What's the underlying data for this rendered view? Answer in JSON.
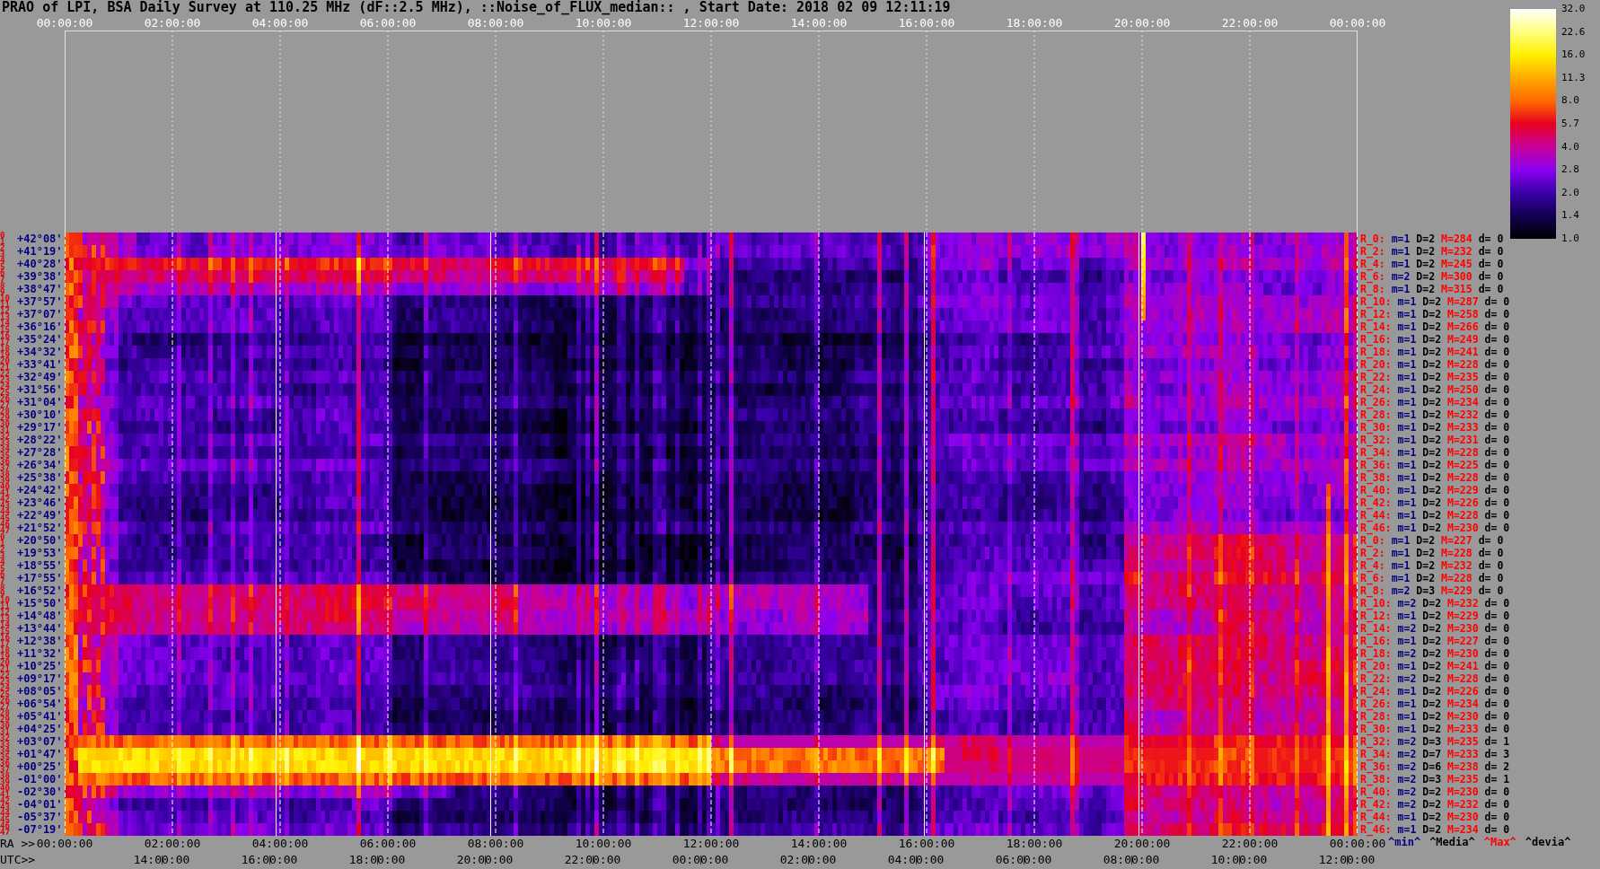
{
  "title": "PRAO of LPI, BSA Daily Survey at 110.25 MHz (dF::2.5 MHz), ::Noise_of_FLUX_median:: , Start Date: 2018 02 09 12:11:19",
  "top_axis": {
    "ticks": [
      "00:00:00",
      "02:00:00",
      "04:00:00",
      "06:00:00",
      "08:00:00",
      "10:00:00",
      "12:00:00",
      "14:00:00",
      "16:00:00",
      "18:00:00",
      "20:00:00",
      "22:00:00",
      "00:00:00"
    ]
  },
  "color_scale": {
    "labels": [
      "32.0",
      "22.6",
      "16.0",
      "11.3",
      "8.0",
      "5.7",
      "4.0",
      "2.8",
      "2.0",
      "1.4",
      "1.0"
    ]
  },
  "rows": [
    {
      "index": [
        "0",
        "1"
      ],
      "declination": "+42°08'",
      "beam": "R_0:",
      "min": "m=1",
      "median": "D=2",
      "max": "M=284",
      "dev": "d= 0"
    },
    {
      "index": [
        "2",
        "3"
      ],
      "declination": "+41°19'",
      "beam": "R_2:",
      "min": "m=1",
      "median": "D=2",
      "max": "M=232",
      "dev": "d= 0"
    },
    {
      "index": [
        "4",
        "5"
      ],
      "declination": "+40°28'",
      "beam": "R_4:",
      "min": "m=1",
      "median": "D=2",
      "max": "M=245",
      "dev": "d= 0"
    },
    {
      "index": [
        "6",
        "7"
      ],
      "declination": "+39°38'",
      "beam": "R_6:",
      "min": "m=2",
      "median": "D=2",
      "max": "M=300",
      "dev": "d= 0"
    },
    {
      "index": [
        "8",
        "9"
      ],
      "declination": "+38°47'",
      "beam": "R_8:",
      "min": "m=1",
      "median": "D=2",
      "max": "M=315",
      "dev": "d= 0"
    },
    {
      "index": [
        "10",
        "11"
      ],
      "declination": "+37°57'",
      "beam": "R_10:",
      "min": "m=1",
      "median": "D=2",
      "max": "M=287",
      "dev": "d= 0"
    },
    {
      "index": [
        "12",
        "13"
      ],
      "declination": "+37°07'",
      "beam": "R_12:",
      "min": "m=1",
      "median": "D=2",
      "max": "M=258",
      "dev": "d= 0"
    },
    {
      "index": [
        "14",
        "15"
      ],
      "declination": "+36°16'",
      "beam": "R_14:",
      "min": "m=1",
      "median": "D=2",
      "max": "M=266",
      "dev": "d= 0"
    },
    {
      "index": [
        "16",
        "17"
      ],
      "declination": "+35°24'",
      "beam": "R_16:",
      "min": "m=1",
      "median": "D=2",
      "max": "M=249",
      "dev": "d= 0"
    },
    {
      "index": [
        "18",
        "19"
      ],
      "declination": "+34°32'",
      "beam": "R_18:",
      "min": "m=1",
      "median": "D=2",
      "max": "M=241",
      "dev": "d= 0"
    },
    {
      "index": [
        "20",
        "21"
      ],
      "declination": "+33°41'",
      "beam": "R_20:",
      "min": "m=1",
      "median": "D=2",
      "max": "M=228",
      "dev": "d= 0"
    },
    {
      "index": [
        "22",
        "23"
      ],
      "declination": "+32°49'",
      "beam": "R_22:",
      "min": "m=1",
      "median": "D=2",
      "max": "M=235",
      "dev": "d= 0"
    },
    {
      "index": [
        "24",
        "25"
      ],
      "declination": "+31°56'",
      "beam": "R_24:",
      "min": "m=1",
      "median": "D=2",
      "max": "M=250",
      "dev": "d= 0"
    },
    {
      "index": [
        "26",
        "27"
      ],
      "declination": "+31°04'",
      "beam": "R_26:",
      "min": "m=1",
      "median": "D=2",
      "max": "M=234",
      "dev": "d= 0"
    },
    {
      "index": [
        "28",
        "29"
      ],
      "declination": "+30°10'",
      "beam": "R_28:",
      "min": "m=1",
      "median": "D=2",
      "max": "M=232",
      "dev": "d= 0"
    },
    {
      "index": [
        "30",
        "31"
      ],
      "declination": "+29°17'",
      "beam": "R_30:",
      "min": "m=1",
      "median": "D=2",
      "max": "M=233",
      "dev": "d= 0"
    },
    {
      "index": [
        "32",
        "33"
      ],
      "declination": "+28°22'",
      "beam": "R_32:",
      "min": "m=1",
      "median": "D=2",
      "max": "M=231",
      "dev": "d= 0"
    },
    {
      "index": [
        "34",
        "35"
      ],
      "declination": "+27°28'",
      "beam": "R_34:",
      "min": "m=1",
      "median": "D=2",
      "max": "M=228",
      "dev": "d= 0"
    },
    {
      "index": [
        "36",
        "37"
      ],
      "declination": "+26°34'",
      "beam": "R_36:",
      "min": "m=1",
      "median": "D=2",
      "max": "M=225",
      "dev": "d= 0"
    },
    {
      "index": [
        "38",
        "39"
      ],
      "declination": "+25°38'",
      "beam": "R_38:",
      "min": "m=1",
      "median": "D=2",
      "max": "M=228",
      "dev": "d= 0"
    },
    {
      "index": [
        "40",
        "41"
      ],
      "declination": "+24°42'",
      "beam": "R_40:",
      "min": "m=1",
      "median": "D=2",
      "max": "M=229",
      "dev": "d= 0"
    },
    {
      "index": [
        "42",
        "43"
      ],
      "declination": "+23°46'",
      "beam": "R_42:",
      "min": "m=1",
      "median": "D=2",
      "max": "M=226",
      "dev": "d= 0"
    },
    {
      "index": [
        "44",
        "45"
      ],
      "declination": "+22°49'",
      "beam": "R_44:",
      "min": "m=1",
      "median": "D=2",
      "max": "M=228",
      "dev": "d= 0"
    },
    {
      "index": [
        "46",
        "47"
      ],
      "declination": "+21°52'",
      "beam": "R_46:",
      "min": "m=1",
      "median": "D=2",
      "max": "M=230",
      "dev": "d= 0"
    },
    {
      "index": [
        "0",
        "1"
      ],
      "declination": "+20°50'",
      "beam": "R_0:",
      "min": "m=1",
      "median": "D=2",
      "max": "M=227",
      "dev": "d= 0"
    },
    {
      "index": [
        "2",
        "3"
      ],
      "declination": "+19°53'",
      "beam": "R_2:",
      "min": "m=1",
      "median": "D=2",
      "max": "M=228",
      "dev": "d= 0"
    },
    {
      "index": [
        "4",
        "5"
      ],
      "declination": "+18°55'",
      "beam": "R_4:",
      "min": "m=1",
      "median": "D=2",
      "max": "M=232",
      "dev": "d= 0"
    },
    {
      "index": [
        "6",
        "7"
      ],
      "declination": "+17°55'",
      "beam": "R_6:",
      "min": "m=1",
      "median": "D=2",
      "max": "M=228",
      "dev": "d= 0"
    },
    {
      "index": [
        "8",
        "9"
      ],
      "declination": "+16°52'",
      "beam": "R_8:",
      "min": "m=2",
      "median": "D=3",
      "max": "M=229",
      "dev": "d= 0"
    },
    {
      "index": [
        "10",
        "11"
      ],
      "declination": "+15°50'",
      "beam": "R_10:",
      "min": "m=2",
      "median": "D=2",
      "max": "M=232",
      "dev": "d= 0"
    },
    {
      "index": [
        "12",
        "13"
      ],
      "declination": "+14°48'",
      "beam": "R_12:",
      "min": "m=1",
      "median": "D=2",
      "max": "M=229",
      "dev": "d= 0"
    },
    {
      "index": [
        "14",
        "15"
      ],
      "declination": "+13°44'",
      "beam": "R_14:",
      "min": "m=2",
      "median": "D=2",
      "max": "M=230",
      "dev": "d= 0"
    },
    {
      "index": [
        "16",
        "17"
      ],
      "declination": "+12°38'",
      "beam": "R_16:",
      "min": "m=1",
      "median": "D=2",
      "max": "M=227",
      "dev": "d= 0"
    },
    {
      "index": [
        "18",
        "19"
      ],
      "declination": "+11°32'",
      "beam": "R_18:",
      "min": "m=2",
      "median": "D=2",
      "max": "M=230",
      "dev": "d= 0"
    },
    {
      "index": [
        "20",
        "21"
      ],
      "declination": "+10°25'",
      "beam": "R_20:",
      "min": "m=1",
      "median": "D=2",
      "max": "M=241",
      "dev": "d= 0"
    },
    {
      "index": [
        "22",
        "23"
      ],
      "declination": "+09°17'",
      "beam": "R_22:",
      "min": "m=2",
      "median": "D=2",
      "max": "M=228",
      "dev": "d= 0"
    },
    {
      "index": [
        "24",
        "25"
      ],
      "declination": "+08°05'",
      "beam": "R_24:",
      "min": "m=1",
      "median": "D=2",
      "max": "M=226",
      "dev": "d= 0"
    },
    {
      "index": [
        "26",
        "27"
      ],
      "declination": "+06°54'",
      "beam": "R_26:",
      "min": "m=1",
      "median": "D=2",
      "max": "M=234",
      "dev": "d= 0"
    },
    {
      "index": [
        "28",
        "29"
      ],
      "declination": "+05°41'",
      "beam": "R_28:",
      "min": "m=1",
      "median": "D=2",
      "max": "M=230",
      "dev": "d= 0"
    },
    {
      "index": [
        "30",
        "31"
      ],
      "declination": "+04°25'",
      "beam": "R_30:",
      "min": "m=1",
      "median": "D=2",
      "max": "M=233",
      "dev": "d= 0"
    },
    {
      "index": [
        "32",
        "33"
      ],
      "declination": "+03°07'",
      "beam": "R_32:",
      "min": "m=2",
      "median": "D=3",
      "max": "M=235",
      "dev": "d= 1"
    },
    {
      "index": [
        "34",
        "35"
      ],
      "declination": "+01°47'",
      "beam": "R_34:",
      "min": "m=2",
      "median": "D=7",
      "max": "M=233",
      "dev": "d= 3"
    },
    {
      "index": [
        "36",
        "37"
      ],
      "declination": "+00°25'",
      "beam": "R_36:",
      "min": "m=2",
      "median": "D=6",
      "max": "M=238",
      "dev": "d= 2"
    },
    {
      "index": [
        "38",
        "39"
      ],
      "declination": "-01°00'",
      "beam": "R_38:",
      "min": "m=2",
      "median": "D=3",
      "max": "M=235",
      "dev": "d= 1"
    },
    {
      "index": [
        "40",
        "41"
      ],
      "declination": "-02°30'",
      "beam": "R_40:",
      "min": "m=2",
      "median": "D=2",
      "max": "M=230",
      "dev": "d= 0"
    },
    {
      "index": [
        "42",
        "43"
      ],
      "declination": "-04°01'",
      "beam": "R_42:",
      "min": "m=2",
      "median": "D=2",
      "max": "M=232",
      "dev": "d= 0"
    },
    {
      "index": [
        "44",
        "45"
      ],
      "declination": "-05°37'",
      "beam": "R_44:",
      "min": "m=1",
      "median": "D=2",
      "max": "M=230",
      "dev": "d= 0"
    },
    {
      "index": [
        "46",
        "47"
      ],
      "declination": "-07°19'",
      "beam": "R_46:",
      "min": "m=1",
      "median": "D=2",
      "max": "M=234",
      "dev": "d= 0"
    }
  ],
  "bottom_axis": {
    "ra_label": "RA >>",
    "ra_ticks": [
      "00:00:00",
      "02:00:00",
      "04:00:00",
      "06:00:00",
      "08:00:00",
      "10:00:00",
      "12:00:00",
      "14:00:00",
      "16:00:00",
      "18:00:00",
      "20:00:00",
      "22:00:00",
      "00:00:00"
    ],
    "utc_label": "UTC>>",
    "utc_ticks": [
      "14:00:00",
      "16:00:00",
      "18:00:00",
      "20:00:00",
      "22:00:00",
      "00:00:00",
      "02:00:00",
      "04:00:00",
      "06:00:00",
      "08:00:00",
      "10:00:00",
      "12:00:00"
    ]
  },
  "stats_legend": [
    {
      "text": "^min^",
      "kind": "min"
    },
    {
      "text": "^Media^",
      "kind": "median"
    },
    {
      "text": "^Max^",
      "kind": "max"
    },
    {
      "text": "^devia^",
      "kind": "dev"
    }
  ]
}
